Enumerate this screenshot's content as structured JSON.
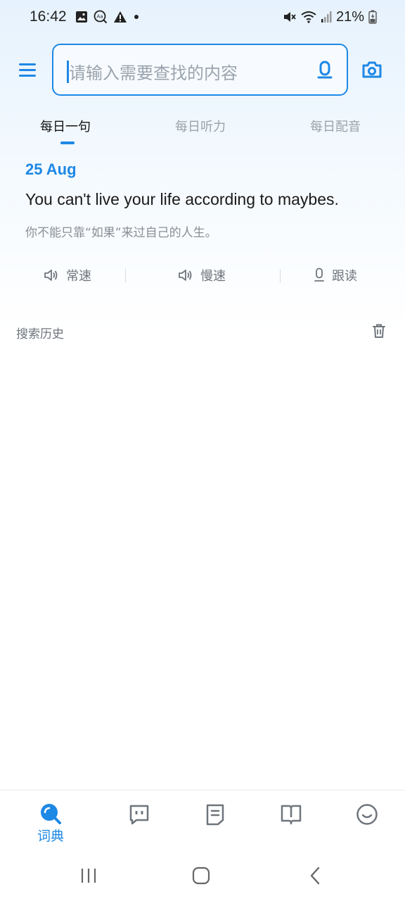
{
  "status_bar": {
    "time": "16:42",
    "battery": "21%",
    "left_icons": [
      "gallery-icon",
      "translate-icon",
      "warning-icon",
      "dot-icon"
    ],
    "right_icons": [
      "mute-icon",
      "wifi-icon",
      "signal-icon",
      "battery-icon"
    ]
  },
  "search": {
    "placeholder": "请输入需要查找的内容"
  },
  "tabs": [
    {
      "label": "每日一句",
      "active": true
    },
    {
      "label": "每日听力",
      "active": false
    },
    {
      "label": "每日配音",
      "active": false
    }
  ],
  "daily_sentence": {
    "date": "25 Aug",
    "english": "You can't live your life according to maybes.",
    "chinese": "你不能只靠“如果”来过自己的人生。"
  },
  "audio_controls": {
    "normal": "常速",
    "slow": "慢速",
    "follow": "跟读"
  },
  "history": {
    "title": "搜索历史"
  },
  "bottom_nav": {
    "dictionary": "词典"
  },
  "colors": {
    "accent": "#1e88e5",
    "muted_text": "#8a8f95",
    "icon_gray": "#6f757c"
  }
}
